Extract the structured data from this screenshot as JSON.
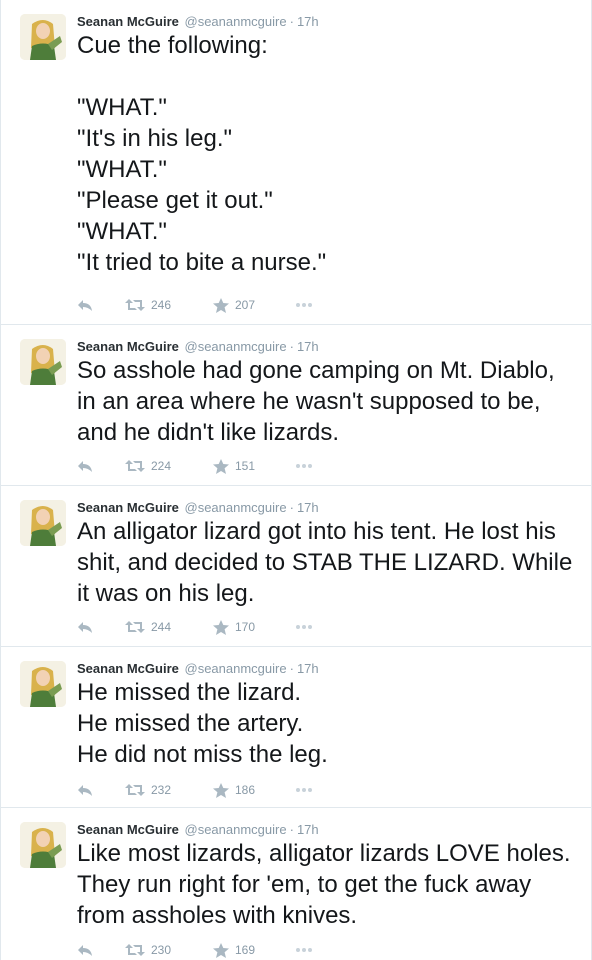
{
  "colors": {
    "name": "#292f33",
    "meta": "#8899a6",
    "text": "#14171a",
    "icon": "#aab8c2",
    "divider": "#e1e8ed"
  },
  "icons": {
    "reply": "reply-icon",
    "retweet": "retweet-icon",
    "favorite": "star-icon",
    "more": "more-dots-icon"
  },
  "tweets": [
    {
      "name": "Seanan McGuire",
      "handle": "@seananmcguire",
      "separator": "·",
      "time": "17h",
      "text": "Cue the following:\n\n\"WHAT.\"\n\"It's in his leg.\"\n\"WHAT.\"\n\"Please get it out.\"\n\"WHAT.\"\n\"It tried to bite a nurse.\"",
      "retweets": "246",
      "favorites": "207"
    },
    {
      "name": "Seanan McGuire",
      "handle": "@seananmcguire",
      "separator": "·",
      "time": "17h",
      "text": "So asshole had gone camping on Mt. Diablo, in an area where he wasn't supposed to be, and he didn't like lizards.",
      "retweets": "224",
      "favorites": "151"
    },
    {
      "name": "Seanan McGuire",
      "handle": "@seananmcguire",
      "separator": "·",
      "time": "17h",
      "text": "An alligator lizard got into his tent. He lost his shit, and decided to STAB THE LIZARD. While it was on his leg.",
      "retweets": "244",
      "favorites": "170"
    },
    {
      "name": "Seanan McGuire",
      "handle": "@seananmcguire",
      "separator": "·",
      "time": "17h",
      "text": "He missed the lizard.\nHe missed the artery.\nHe did not miss the leg.",
      "retweets": "232",
      "favorites": "186"
    },
    {
      "name": "Seanan McGuire",
      "handle": "@seananmcguire",
      "separator": "·",
      "time": "17h",
      "text": "Like most lizards, alligator lizards LOVE holes. They run right for 'em, to get the fuck away from assholes with knives.",
      "retweets": "230",
      "favorites": "169"
    }
  ]
}
